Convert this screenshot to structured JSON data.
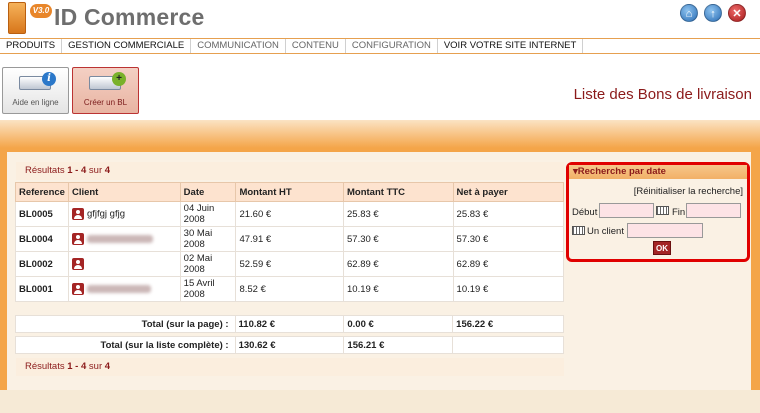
{
  "app": {
    "logo_badge": "V3.0",
    "logo_text": "ID Commerce",
    "colors": {
      "accent_orange": "#f4a549",
      "brand_red": "#a42525",
      "title_red": "#8b1a1a"
    }
  },
  "header_icons": [
    "home-icon",
    "up-arrow-icon",
    "close-icon"
  ],
  "nav": {
    "items": [
      {
        "label": "PRODUITS"
      },
      {
        "label": "GESTION COMMERCIALE"
      },
      {
        "label": "COMMUNICATION"
      },
      {
        "label": "CONTENU"
      },
      {
        "label": "CONFIGURATION"
      },
      {
        "label": "VOIR VOTRE SITE INTERNET"
      }
    ]
  },
  "toolbar": {
    "help_label": "Aide en ligne",
    "new_label": "Créer un BL",
    "help_badge": "i",
    "new_badge": "+"
  },
  "page_title": "Liste des Bons de livraison",
  "results": {
    "prefix": "Résultats ",
    "range": "1 - 4",
    "middle": " sur ",
    "total": "4"
  },
  "table": {
    "headers": [
      "Reference",
      "Client",
      "Date",
      "Montant HT",
      "Montant TTC",
      "Net à payer"
    ],
    "rows": [
      {
        "reference": "BL0005",
        "client": "gfjfgj gfjg",
        "date": "04 Juin 2008",
        "ht": "21.60 €",
        "ttc": "25.83 €",
        "net": "25.83 €"
      },
      {
        "reference": "BL0004",
        "client": "",
        "date": "30 Mai 2008",
        "ht": "47.91 €",
        "ttc": "57.30 €",
        "net": "57.30 €"
      },
      {
        "reference": "BL0002",
        "client": "",
        "date": "02 Mai 2008",
        "ht": "52.59 €",
        "ttc": "62.89 €",
        "net": "62.89 €"
      },
      {
        "reference": "BL0001",
        "client": "",
        "date": "15 Avril 2008",
        "ht": "8.52 €",
        "ttc": "10.19 €",
        "net": "10.19 €"
      }
    ]
  },
  "totals": {
    "page_label": "Total (sur la page) :",
    "page_ht": "110.82 €",
    "page_ttc": "0.00 €",
    "page_net": "156.22 €",
    "list_label": "Total (sur la liste complète) :",
    "list_ht": "130.62 €",
    "list_ttc": "156.21 €"
  },
  "search": {
    "title": "Recherche par date",
    "reset": "[Réinitialiser la recherche]",
    "debut_label": "Début",
    "fin_label": "Fin",
    "client_label": "Un client",
    "ok_label": "OK",
    "debut_value": "",
    "fin_value": "",
    "client_value": ""
  }
}
